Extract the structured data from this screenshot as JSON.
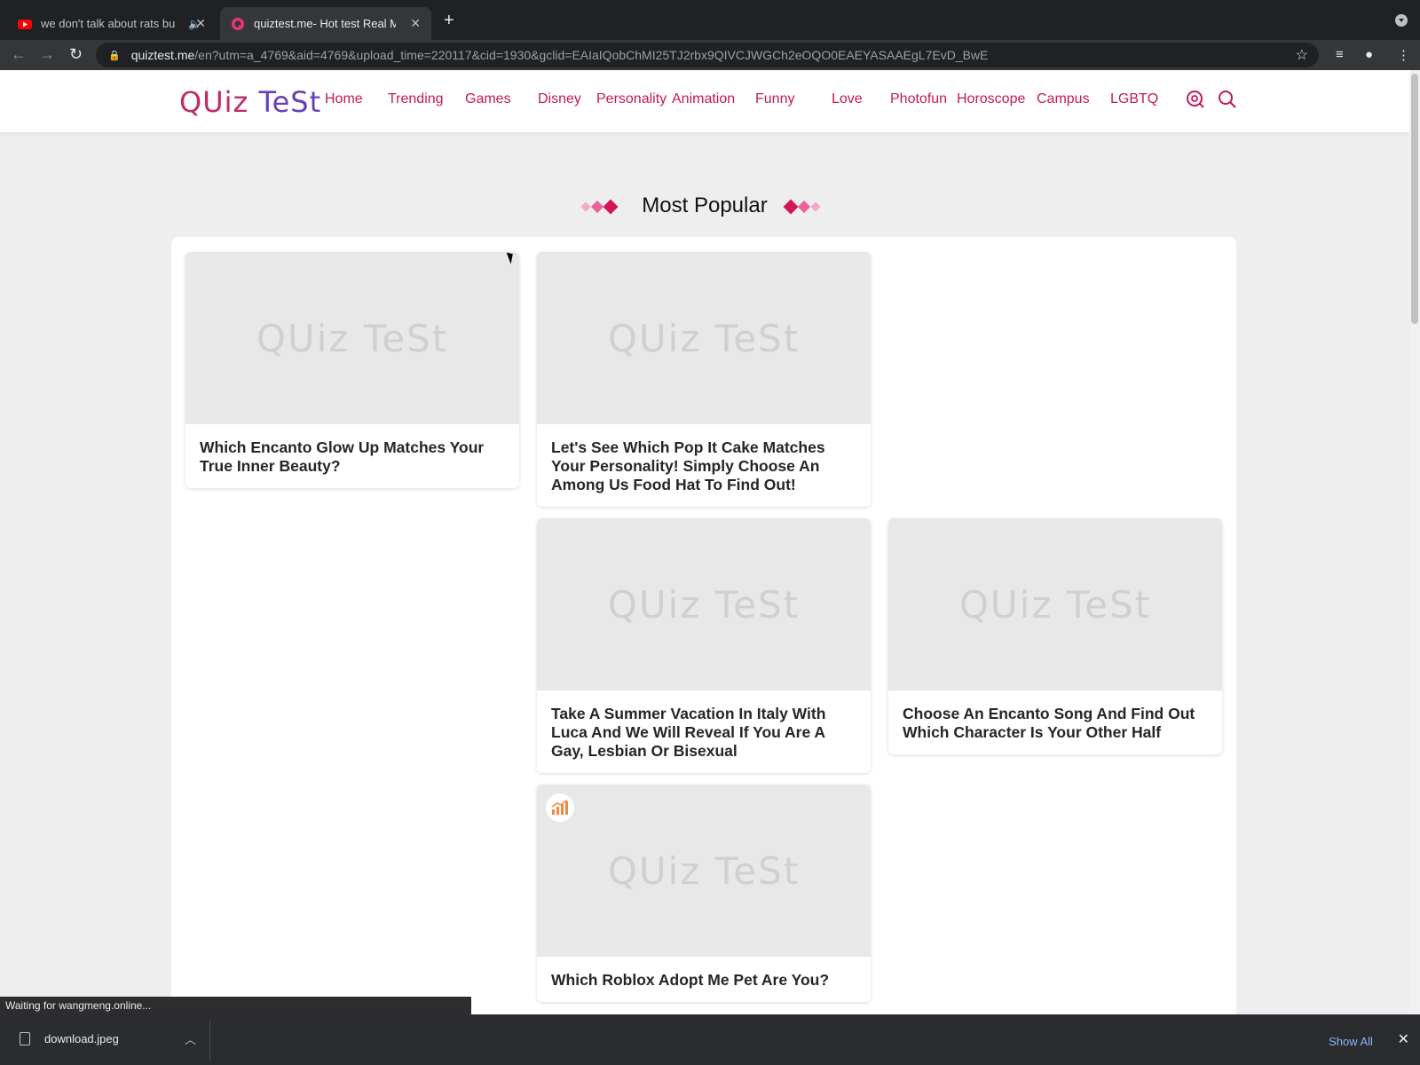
{
  "browser": {
    "tabs": [
      {
        "title": "we don't talk about rats bu",
        "active": false,
        "muted_icon": "🔈"
      },
      {
        "title": "quiztest.me- Hot test Real Me",
        "active": true
      }
    ],
    "address": {
      "host": "quiztest.me",
      "path": "/en?utm=a_4769&aid=4769&upload_time=220117&cid=1930&gclid=EAIaIQobChMI25TJ2rbx9QIVCJWGCh2eOQO0EAEYASAAEgL7EvD_BwE"
    },
    "status_text": "Waiting for wangmeng.online...",
    "download": {
      "filename": "download.jpeg",
      "show_all": "Show All"
    }
  },
  "site": {
    "logo": {
      "part1": "QUiz ",
      "part2": "TeSt"
    },
    "nav": [
      "Home",
      "Trending",
      "Games",
      "Disney",
      "Personality",
      "Animation",
      "Funny",
      "Love",
      "Photofun",
      "Horoscope",
      "Campus",
      "LGBTQ"
    ],
    "section_title": "Most Popular",
    "watermark": "QUiz TeSt",
    "cards": [
      {
        "title": "Which Encanto Glow Up Matches Your True Inner Beauty?"
      },
      {
        "title": "Let's See Which Pop It Cake Matches Your Personality! Simply Choose An Among Us Food Hat To Find Out!"
      },
      {
        "title": "Take A Summer Vacation In Italy With Luca And We Will Reveal If You Are A Gay, Lesbian Or Bisexual"
      },
      {
        "title": "Choose An Encanto Song And Find Out Which Character Is Your Other Half"
      },
      {
        "title": "Which Roblox Adopt Me Pet Are You?",
        "badge": "trending-chart-icon"
      }
    ]
  },
  "colors": {
    "brand": "#c3185b",
    "logo_purple": "#6a3fb5",
    "chrome_dark": "#202124",
    "accent_orange": "#f08a3e"
  }
}
